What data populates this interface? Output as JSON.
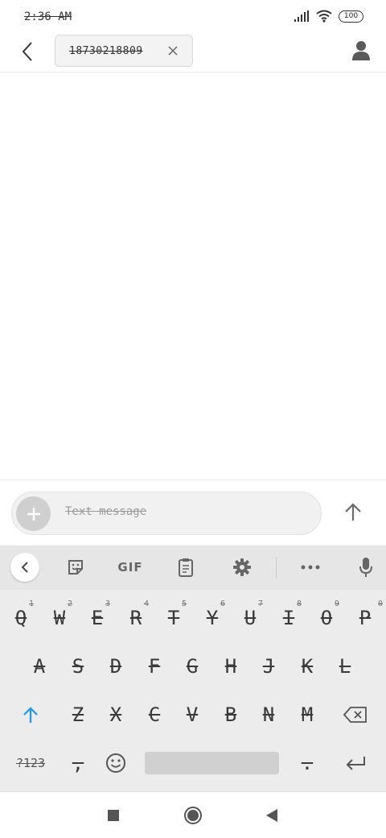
{
  "status_bar": {
    "time": "2:36 AM",
    "battery": "100"
  },
  "header": {
    "recipient": "18730218809"
  },
  "compose": {
    "placeholder": "Text message"
  },
  "keyboard": {
    "toolbar": {
      "gif_label": "GIF"
    },
    "row1": [
      {
        "letter": "Q",
        "hint": "1"
      },
      {
        "letter": "W",
        "hint": "2"
      },
      {
        "letter": "E",
        "hint": "3"
      },
      {
        "letter": "R",
        "hint": "4"
      },
      {
        "letter": "T",
        "hint": "5"
      },
      {
        "letter": "Y",
        "hint": "6"
      },
      {
        "letter": "U",
        "hint": "7"
      },
      {
        "letter": "I",
        "hint": "8"
      },
      {
        "letter": "O",
        "hint": "9"
      },
      {
        "letter": "P",
        "hint": "0"
      }
    ],
    "row2": [
      "A",
      "S",
      "D",
      "F",
      "G",
      "H",
      "J",
      "K",
      "L"
    ],
    "row3": [
      "Z",
      "X",
      "C",
      "V",
      "B",
      "N",
      "M"
    ],
    "bottom": {
      "symbols_label": "?123",
      "comma": ",",
      "period": "."
    }
  },
  "colors": {
    "shift_accent": "#2196f3",
    "keyboard_bg": "#ececec",
    "toolbar_bg": "#e6e6e6"
  }
}
